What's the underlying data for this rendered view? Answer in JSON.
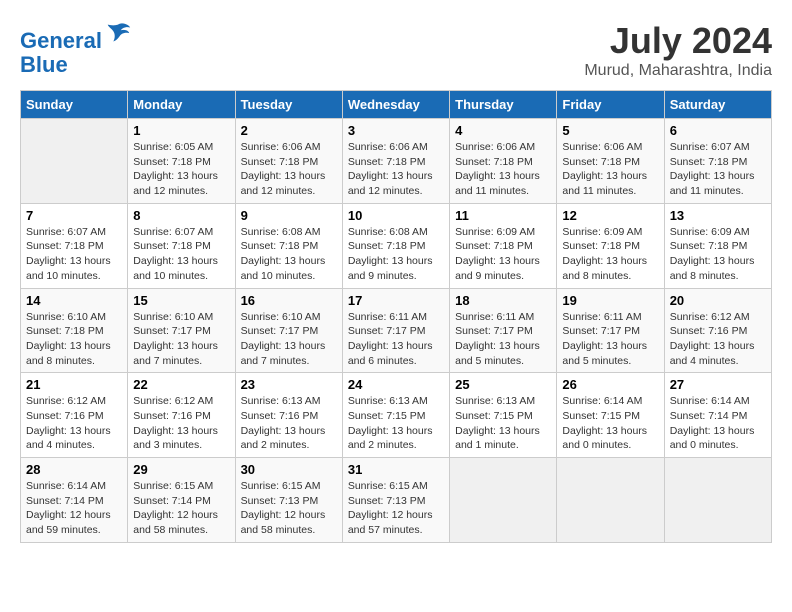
{
  "header": {
    "logo_line1": "General",
    "logo_line2": "Blue",
    "month": "July 2024",
    "location": "Murud, Maharashtra, India"
  },
  "columns": [
    "Sunday",
    "Monday",
    "Tuesday",
    "Wednesday",
    "Thursday",
    "Friday",
    "Saturday"
  ],
  "weeks": [
    [
      {
        "day": "",
        "info": ""
      },
      {
        "day": "1",
        "info": "Sunrise: 6:05 AM\nSunset: 7:18 PM\nDaylight: 13 hours\nand 12 minutes."
      },
      {
        "day": "2",
        "info": "Sunrise: 6:06 AM\nSunset: 7:18 PM\nDaylight: 13 hours\nand 12 minutes."
      },
      {
        "day": "3",
        "info": "Sunrise: 6:06 AM\nSunset: 7:18 PM\nDaylight: 13 hours\nand 12 minutes."
      },
      {
        "day": "4",
        "info": "Sunrise: 6:06 AM\nSunset: 7:18 PM\nDaylight: 13 hours\nand 11 minutes."
      },
      {
        "day": "5",
        "info": "Sunrise: 6:06 AM\nSunset: 7:18 PM\nDaylight: 13 hours\nand 11 minutes."
      },
      {
        "day": "6",
        "info": "Sunrise: 6:07 AM\nSunset: 7:18 PM\nDaylight: 13 hours\nand 11 minutes."
      }
    ],
    [
      {
        "day": "7",
        "info": "Sunrise: 6:07 AM\nSunset: 7:18 PM\nDaylight: 13 hours\nand 10 minutes."
      },
      {
        "day": "8",
        "info": "Sunrise: 6:07 AM\nSunset: 7:18 PM\nDaylight: 13 hours\nand 10 minutes."
      },
      {
        "day": "9",
        "info": "Sunrise: 6:08 AM\nSunset: 7:18 PM\nDaylight: 13 hours\nand 10 minutes."
      },
      {
        "day": "10",
        "info": "Sunrise: 6:08 AM\nSunset: 7:18 PM\nDaylight: 13 hours\nand 9 minutes."
      },
      {
        "day": "11",
        "info": "Sunrise: 6:09 AM\nSunset: 7:18 PM\nDaylight: 13 hours\nand 9 minutes."
      },
      {
        "day": "12",
        "info": "Sunrise: 6:09 AM\nSunset: 7:18 PM\nDaylight: 13 hours\nand 8 minutes."
      },
      {
        "day": "13",
        "info": "Sunrise: 6:09 AM\nSunset: 7:18 PM\nDaylight: 13 hours\nand 8 minutes."
      }
    ],
    [
      {
        "day": "14",
        "info": "Sunrise: 6:10 AM\nSunset: 7:18 PM\nDaylight: 13 hours\nand 8 minutes."
      },
      {
        "day": "15",
        "info": "Sunrise: 6:10 AM\nSunset: 7:17 PM\nDaylight: 13 hours\nand 7 minutes."
      },
      {
        "day": "16",
        "info": "Sunrise: 6:10 AM\nSunset: 7:17 PM\nDaylight: 13 hours\nand 7 minutes."
      },
      {
        "day": "17",
        "info": "Sunrise: 6:11 AM\nSunset: 7:17 PM\nDaylight: 13 hours\nand 6 minutes."
      },
      {
        "day": "18",
        "info": "Sunrise: 6:11 AM\nSunset: 7:17 PM\nDaylight: 13 hours\nand 5 minutes."
      },
      {
        "day": "19",
        "info": "Sunrise: 6:11 AM\nSunset: 7:17 PM\nDaylight: 13 hours\nand 5 minutes."
      },
      {
        "day": "20",
        "info": "Sunrise: 6:12 AM\nSunset: 7:16 PM\nDaylight: 13 hours\nand 4 minutes."
      }
    ],
    [
      {
        "day": "21",
        "info": "Sunrise: 6:12 AM\nSunset: 7:16 PM\nDaylight: 13 hours\nand 4 minutes."
      },
      {
        "day": "22",
        "info": "Sunrise: 6:12 AM\nSunset: 7:16 PM\nDaylight: 13 hours\nand 3 minutes."
      },
      {
        "day": "23",
        "info": "Sunrise: 6:13 AM\nSunset: 7:16 PM\nDaylight: 13 hours\nand 2 minutes."
      },
      {
        "day": "24",
        "info": "Sunrise: 6:13 AM\nSunset: 7:15 PM\nDaylight: 13 hours\nand 2 minutes."
      },
      {
        "day": "25",
        "info": "Sunrise: 6:13 AM\nSunset: 7:15 PM\nDaylight: 13 hours\nand 1 minute."
      },
      {
        "day": "26",
        "info": "Sunrise: 6:14 AM\nSunset: 7:15 PM\nDaylight: 13 hours\nand 0 minutes."
      },
      {
        "day": "27",
        "info": "Sunrise: 6:14 AM\nSunset: 7:14 PM\nDaylight: 13 hours\nand 0 minutes."
      }
    ],
    [
      {
        "day": "28",
        "info": "Sunrise: 6:14 AM\nSunset: 7:14 PM\nDaylight: 12 hours\nand 59 minutes."
      },
      {
        "day": "29",
        "info": "Sunrise: 6:15 AM\nSunset: 7:14 PM\nDaylight: 12 hours\nand 58 minutes."
      },
      {
        "day": "30",
        "info": "Sunrise: 6:15 AM\nSunset: 7:13 PM\nDaylight: 12 hours\nand 58 minutes."
      },
      {
        "day": "31",
        "info": "Sunrise: 6:15 AM\nSunset: 7:13 PM\nDaylight: 12 hours\nand 57 minutes."
      },
      {
        "day": "",
        "info": ""
      },
      {
        "day": "",
        "info": ""
      },
      {
        "day": "",
        "info": ""
      }
    ]
  ]
}
